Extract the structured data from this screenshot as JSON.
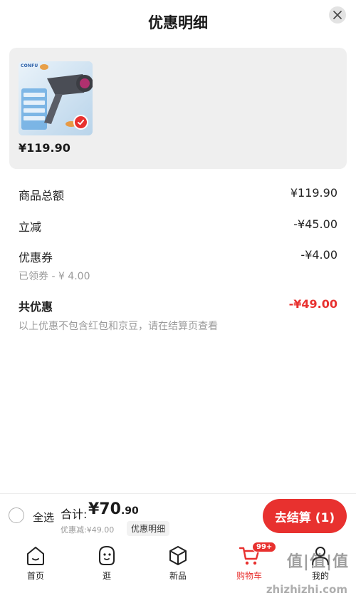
{
  "sheet": {
    "title": "优惠明细",
    "close_icon": "close-icon"
  },
  "product": {
    "brand_text": "CONFU",
    "price": "¥119.90",
    "selected": true
  },
  "breakdown": {
    "subtotal_label": "商品总额",
    "subtotal_value": "¥119.90",
    "instant_discount_label": "立减",
    "instant_discount_value": "-¥45.00",
    "coupon_label": "优惠券",
    "coupon_value": "-¥4.00",
    "coupon_note": "已领券 - ¥ 4.00",
    "total_discount_label": "共优惠",
    "total_discount_value": "-¥49.00",
    "footnote": "以上优惠不包含红包和京豆，请在结算页查看"
  },
  "checkout_bar": {
    "select_all_label": "全选",
    "total_label": "合计:",
    "total_yen": "¥70",
    "total_cents": ".90",
    "discount_line": "优惠减:¥49.00",
    "detail_chip": "优惠明细",
    "checkout_button": "去结算 (1)"
  },
  "tabbar": {
    "items": [
      {
        "label": "首页",
        "icon": "home-icon"
      },
      {
        "label": "逛",
        "icon": "stroll-face-icon"
      },
      {
        "label": "新品",
        "icon": "new-box-icon"
      },
      {
        "label": "购物车",
        "icon": "cart-icon",
        "badge": "99+",
        "active": true
      },
      {
        "label": "我的",
        "icon": "profile-icon"
      }
    ]
  },
  "watermark": {
    "logo_text": "值|值|值",
    "url": "zhizhizhi.com"
  },
  "colors": {
    "accent": "#e8312f",
    "muted": "#9a9a9a"
  }
}
